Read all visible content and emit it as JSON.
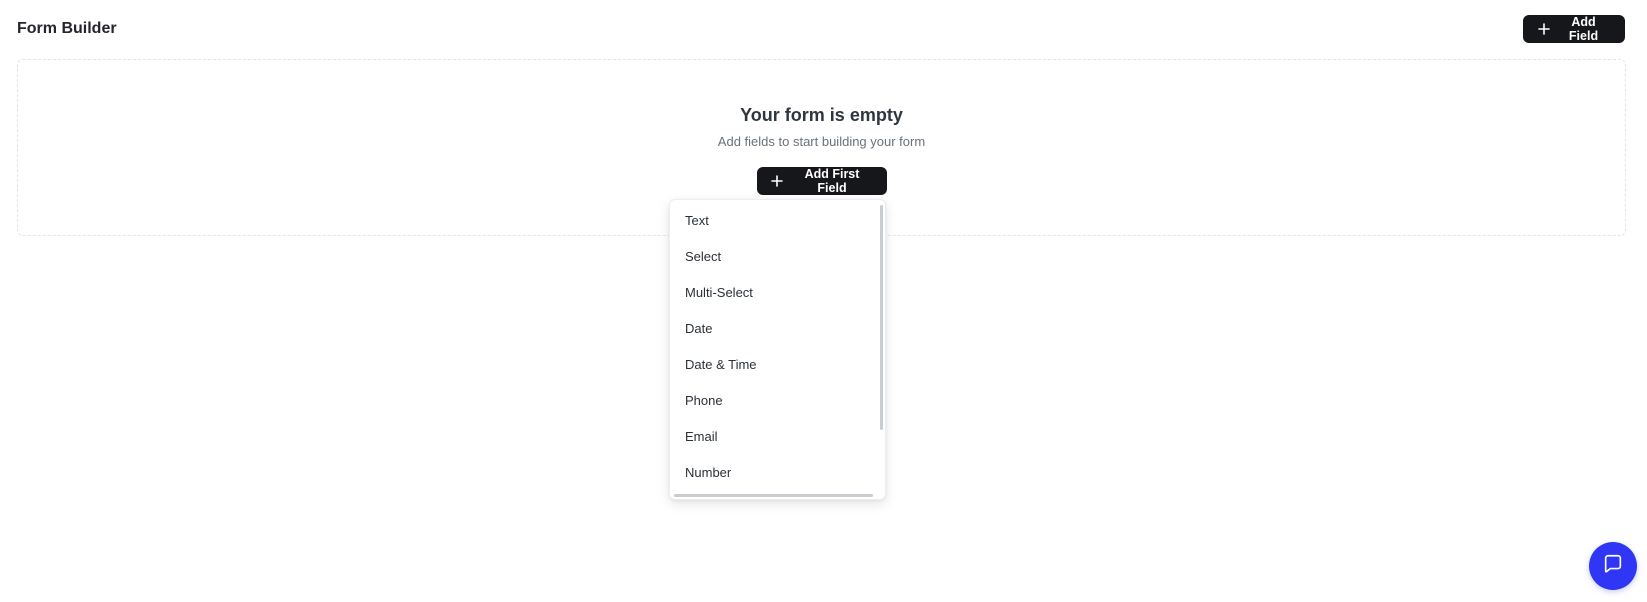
{
  "header": {
    "title": "Form Builder",
    "add_field_label": "Add Field"
  },
  "empty_state": {
    "title": "Your form is empty",
    "subtitle": "Add fields to start building your form",
    "add_first_label": "Add First Field"
  },
  "field_type_menu": {
    "items": [
      {
        "label": "Text"
      },
      {
        "label": "Select"
      },
      {
        "label": "Multi-Select"
      },
      {
        "label": "Date"
      },
      {
        "label": "Date & Time"
      },
      {
        "label": "Phone"
      },
      {
        "label": "Email"
      },
      {
        "label": "Number"
      }
    ]
  },
  "icons": {
    "add": "plus-icon",
    "chat": "chat-bubble-icon"
  },
  "colors": {
    "primary_button": "#16171b",
    "chat_fab": "#2f36f5"
  }
}
